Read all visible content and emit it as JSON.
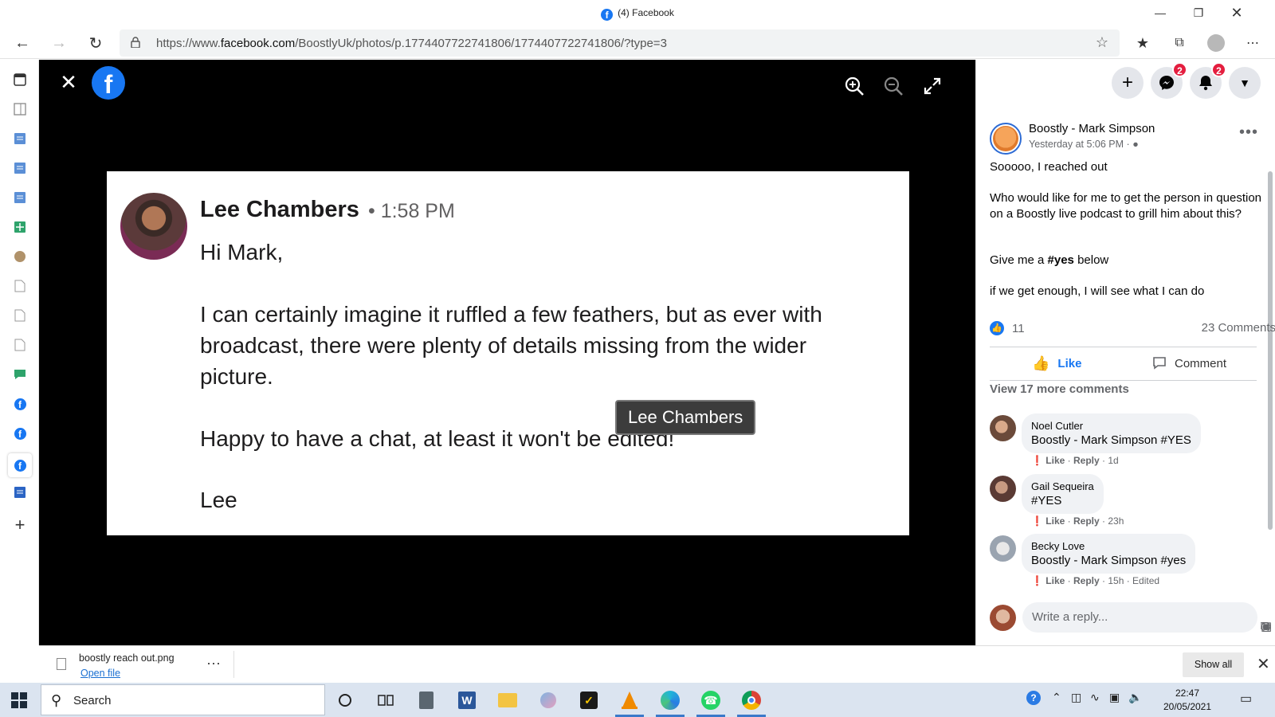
{
  "browser": {
    "tab_title": "(4) Facebook",
    "url_prefix": "https://www.",
    "url_domain": "facebook.com",
    "url_path": "/BoostlyUk/photos/p.1774407722741806/1774407722741806/?type=3"
  },
  "photo": {
    "sender": "Lee Chambers",
    "time": "• 1:58 PM",
    "greeting": "Hi Mark,",
    "line1": "I can certainly imagine it ruffled a few feathers, but as ever with",
    "line2": "broadcast, there were plenty of details missing from the wider",
    "line3": "picture.",
    "line4": "Happy to have a chat, at least it won't be edited!",
    "signoff": "Lee",
    "tooltip": "Lee Chambers"
  },
  "topbar": {
    "messenger_badge": "2",
    "notifications_badge": "2"
  },
  "post": {
    "author": "Boostly - Mark Simpson",
    "timestamp": "Yesterday at 5:06 PM ·",
    "p1": "Sooooo, I reached out",
    "p2": "Who would like for me to get the person in question on a Boostly live podcast to grill him about this?",
    "p3_a": "Give me a ",
    "p3_tag": "#yes",
    "p3_b": " below",
    "p4": "if we get enough, I will see what I can do",
    "likes": "11",
    "comments_count": "23 Comments",
    "like_label": "Like",
    "comment_label": "Comment",
    "view_more": "View 17 more comments",
    "reply_placeholder": "Write a reply..."
  },
  "comments": [
    {
      "name": "Noel Cutler",
      "text": "Boostly - Mark Simpson #YES",
      "like": "Like",
      "reply": "Reply",
      "time": "1d",
      "edited": ""
    },
    {
      "name": "Gail Sequeira",
      "text": "#YES",
      "like": "Like",
      "reply": "Reply",
      "time": "23h",
      "edited": ""
    },
    {
      "name": "Becky Love",
      "text": "Boostly - Mark Simpson #yes",
      "like": "Like",
      "reply": "Reply",
      "time": "15h",
      "edited": "· Edited"
    }
  ],
  "download": {
    "filename": "boostly reach out.png",
    "open_label": "Open file",
    "show_all": "Show all"
  },
  "taskbar": {
    "search_label": "Search",
    "time": "22:47",
    "date": "20/05/2021"
  },
  "colors": {
    "facebook_blue": "#1877f2",
    "badge_red": "#e41e3f",
    "viewer_bg": "#000000"
  }
}
